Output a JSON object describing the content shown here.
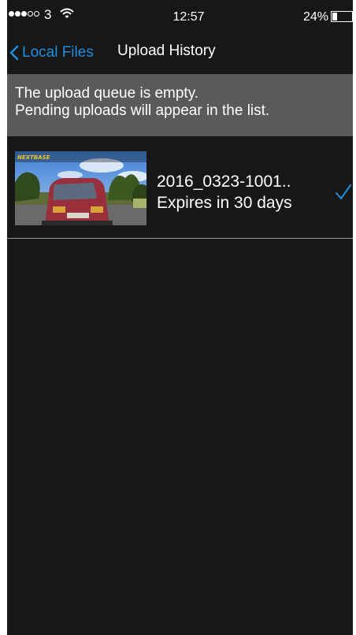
{
  "status_bar": {
    "signal_icon": "signal-strength-icon",
    "carrier": "3",
    "wifi_icon": "wifi-icon",
    "time": "12:57",
    "battery_percent": "24%",
    "battery_level": 0.24,
    "battery_icon": "battery-icon"
  },
  "nav": {
    "back_label": "Local Files",
    "back_icon": "chevron-left-icon",
    "title": "Upload History"
  },
  "queue_banner": {
    "line1": "The upload queue is empty.",
    "line2": "Pending uploads will appear in the list."
  },
  "uploads": [
    {
      "thumbnail_brand": "NEXTBASE",
      "file_name": "2016_0323-1001..",
      "expiry": "Expires in 30 days",
      "status_icon": "checkmark-icon"
    }
  ],
  "colors": {
    "accent": "#1e8fe0",
    "background": "#171717",
    "banner": "#5a5a5a"
  }
}
